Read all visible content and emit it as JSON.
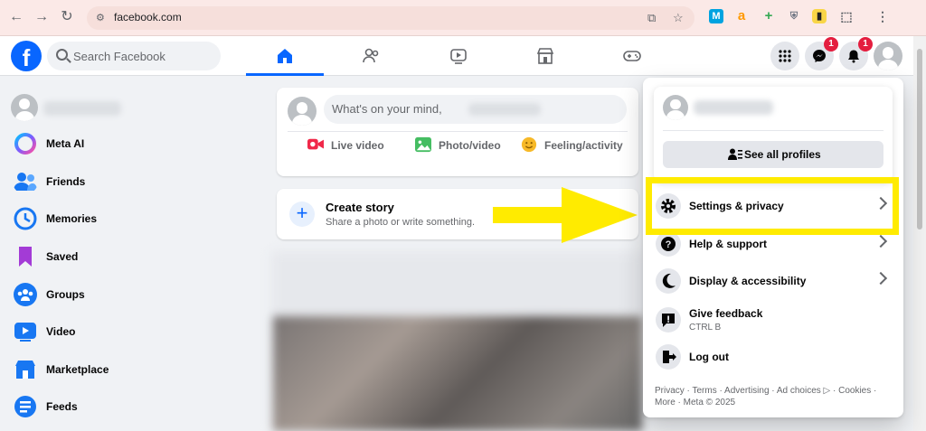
{
  "browser": {
    "url": "facebook.com",
    "colors": {
      "bar": "#fbe9e7"
    }
  },
  "header": {
    "logo_letter": "f",
    "search_placeholder": "Search Facebook",
    "nav_tabs": [
      "home",
      "friends",
      "video",
      "marketplace",
      "gaming"
    ],
    "messenger_badge": "1",
    "notifications_badge": "1"
  },
  "sidebar": {
    "items": [
      {
        "label": "Meta AI",
        "icon": "meta-ai-icon"
      },
      {
        "label": "Friends",
        "icon": "friends-icon"
      },
      {
        "label": "Memories",
        "icon": "memories-icon"
      },
      {
        "label": "Saved",
        "icon": "saved-icon"
      },
      {
        "label": "Groups",
        "icon": "groups-icon"
      },
      {
        "label": "Video",
        "icon": "video-icon"
      },
      {
        "label": "Marketplace",
        "icon": "marketplace-icon"
      },
      {
        "label": "Feeds",
        "icon": "feeds-icon"
      }
    ]
  },
  "composer": {
    "placeholder": "What's on your mind,",
    "actions": [
      {
        "label": "Live video"
      },
      {
        "label": "Photo/video"
      },
      {
        "label": "Feeling/activity"
      }
    ]
  },
  "story": {
    "title": "Create story",
    "subtitle": "Share a photo or write something."
  },
  "menu": {
    "see_all_profiles": "See all profiles",
    "items": [
      {
        "label": "Settings & privacy",
        "sub": ""
      },
      {
        "label": "Help & support",
        "sub": ""
      },
      {
        "label": "Display & accessibility",
        "sub": ""
      },
      {
        "label": "Give feedback",
        "sub": "CTRL B"
      },
      {
        "label": "Log out",
        "sub": ""
      }
    ],
    "footer_line1": "Privacy · Terms · Advertising · Ad choices ▷ · Cookies ·",
    "footer_line2": "More · Meta © 2025"
  },
  "colors": {
    "brand": "#0866ff",
    "highlight": "#ffeb00",
    "badge": "#e41e3f"
  }
}
